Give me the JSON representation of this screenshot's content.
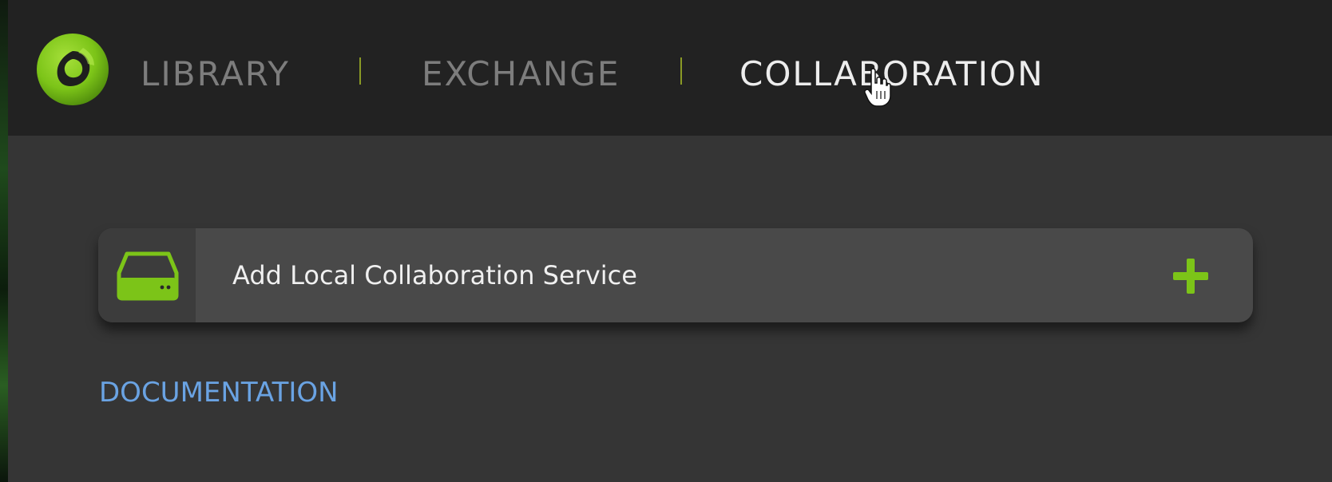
{
  "header": {
    "tabs": [
      {
        "label": "LIBRARY",
        "active": false
      },
      {
        "label": "EXCHANGE",
        "active": false
      },
      {
        "label": "COLLABORATION",
        "active": true
      }
    ]
  },
  "service": {
    "label": "Add Local Collaboration Service",
    "icon": "drive-icon",
    "action_icon": "plus-icon"
  },
  "links": {
    "documentation": "DOCUMENTATION"
  },
  "colors": {
    "accent_green": "#7cc418",
    "header_bg": "#222222",
    "panel_bg": "#353535",
    "card_bg": "#494949",
    "link_blue": "#6aa3e3",
    "tab_inactive": "#7d7d7d",
    "tab_active": "#ededed",
    "divider": "#8a9a25"
  }
}
